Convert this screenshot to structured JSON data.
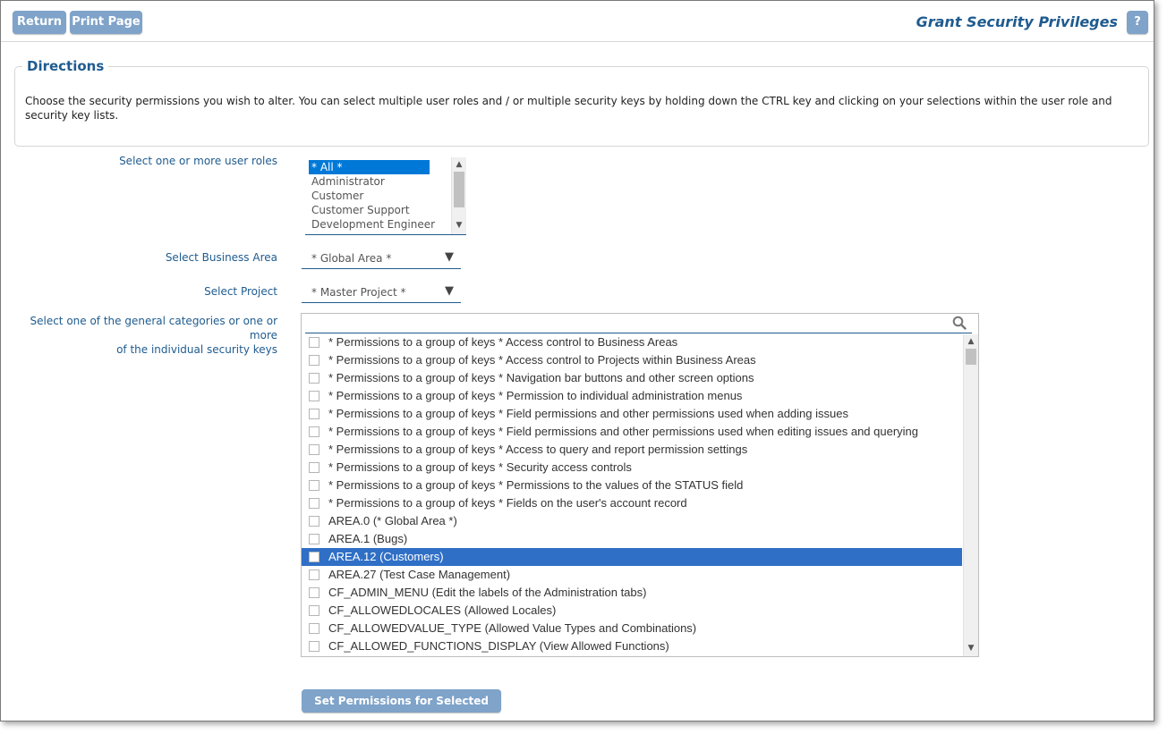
{
  "toolbar": {
    "return_label": "Return",
    "print_label": "Print Page",
    "help_label": "?"
  },
  "page": {
    "title": "Grant Security Privileges"
  },
  "directions": {
    "legend": "Directions",
    "text": "Choose the security permissions you wish to alter. You can select multiple user roles and / or multiple security keys by holding down the CTRL key and clicking on your selections within the user role and security key lists."
  },
  "roles": {
    "label": "Select one or more user roles",
    "items": [
      "* All *",
      "Administrator",
      "Customer",
      "Customer Support",
      "Development Engineer"
    ],
    "selected_index": 0
  },
  "business_area": {
    "label": "Select Business Area",
    "value": "* Global Area *"
  },
  "project": {
    "label": "Select Project",
    "value": "* Master Project *"
  },
  "keys": {
    "label_line1": "Select one of the general categories or one or more",
    "label_line2": "of the individual security keys",
    "search_placeholder": "",
    "items": [
      "* Permissions to a group of keys *  Access control to Business Areas",
      "* Permissions to a group of keys *  Access control to Projects within Business Areas",
      "* Permissions to a group of keys *  Navigation bar buttons and other screen options",
      "* Permissions to a group of keys *  Permission to individual administration menus",
      "* Permissions to a group of keys *  Field permissions and other permissions used when adding issues",
      "* Permissions to a group of keys *  Field permissions and other permissions used when editing issues and querying",
      "* Permissions to a group of keys *  Access to query and report permission settings",
      "* Permissions to a group of keys *  Security access controls",
      "* Permissions to a group of keys *  Permissions to the values of the STATUS field",
      "* Permissions to a group of keys *  Fields on the user's account record",
      "AREA.0 (* Global Area *)",
      "AREA.1 (Bugs)",
      "AREA.12 (Customers)",
      "AREA.27 (Test Case Management)",
      "CF_ADMIN_MENU (Edit the labels of the Administration tabs)",
      "CF_ALLOWEDLOCALES (Allowed Locales)",
      "CF_ALLOWEDVALUE_TYPE (Allowed Value Types and Combinations)",
      "CF_ALLOWED_FUNCTIONS_DISPLAY (View Allowed Functions)"
    ],
    "selected_index": 12
  },
  "submit": {
    "label": "Set Permissions for Selected Keys"
  },
  "colors": {
    "button": "#7fa3c9",
    "accent": "#1f5b8f",
    "selection": "#2f6fc6"
  }
}
